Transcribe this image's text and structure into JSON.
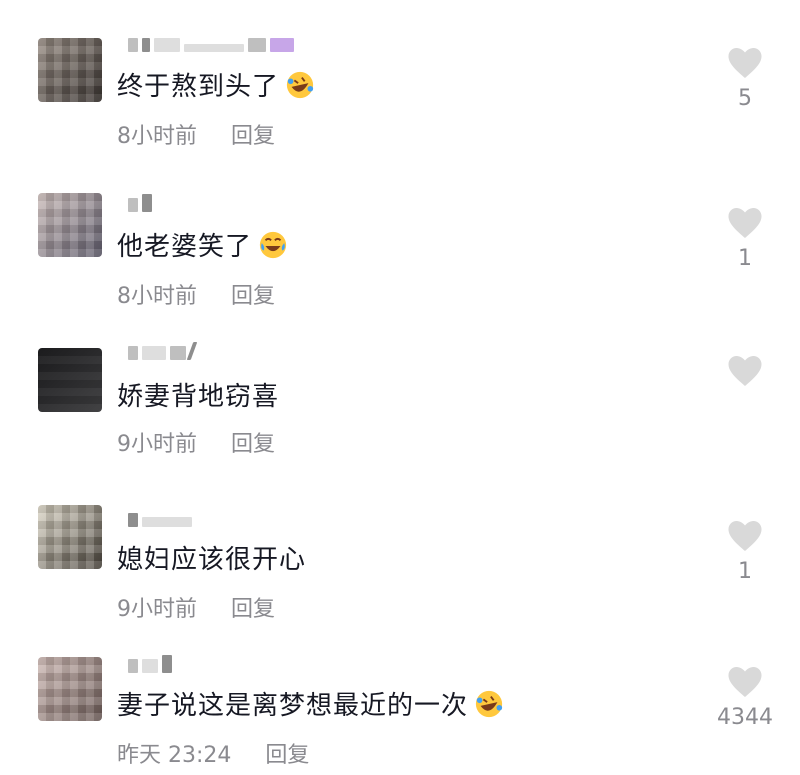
{
  "comments": [
    {
      "text": "终于熬到头了",
      "emoji": "rofl-emoji",
      "time": "8小时前",
      "reply": "回复",
      "likes": "5"
    },
    {
      "text": "他老婆笑了",
      "emoji": "joy-emoji",
      "time": "8小时前",
      "reply": "回复",
      "likes": "1"
    },
    {
      "text": "娇妻背地窃喜",
      "emoji": "",
      "time": "9小时前",
      "reply": "回复",
      "likes": ""
    },
    {
      "text": "媳妇应该很开心",
      "emoji": "",
      "time": "9小时前",
      "reply": "回复",
      "likes": "1"
    },
    {
      "text": "妻子说这是离梦想最近的一次",
      "emoji": "rofl-emoji",
      "time": "昨天 23:24",
      "reply": "回复",
      "likes": "4344"
    }
  ],
  "icons": {
    "like": "heart-icon"
  },
  "colors": {
    "text": "#161823",
    "meta": "#8a8a8f",
    "heart": "#d9d9d9",
    "emoji_face": "#ffc83d"
  }
}
